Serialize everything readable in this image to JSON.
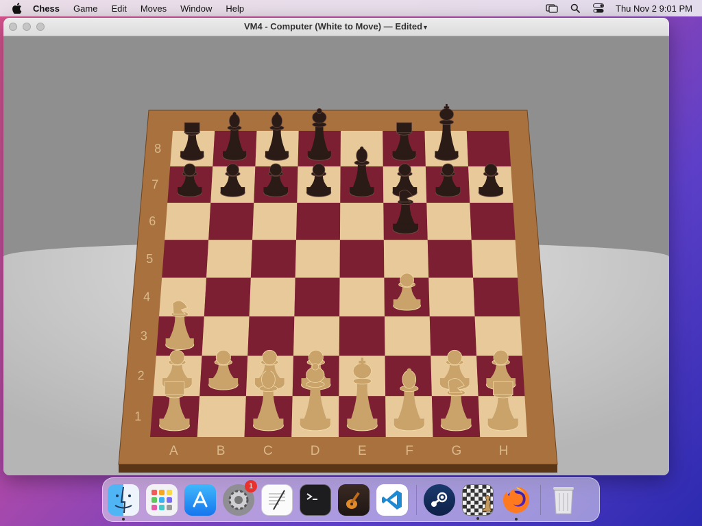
{
  "menubar": {
    "app_name": "Chess",
    "items": [
      "Game",
      "Edit",
      "Moves",
      "Window",
      "Help"
    ],
    "clock": "Thu Nov 2  9:01 PM"
  },
  "window": {
    "title": "VM4 - Computer   (White to Move) —",
    "edited": "Edited"
  },
  "board": {
    "files": [
      "A",
      "B",
      "C",
      "D",
      "E",
      "F",
      "G",
      "H"
    ],
    "ranks": [
      "8",
      "7",
      "6",
      "5",
      "4",
      "3",
      "2",
      "1"
    ],
    "colors": {
      "light": "#e8c99a",
      "dark": "#7d1f33",
      "frame": "#a8713e"
    },
    "pieces": [
      {
        "square": "a8",
        "piece": "rook",
        "color": "black"
      },
      {
        "square": "b8",
        "piece": "bishop",
        "color": "black"
      },
      {
        "square": "c8",
        "piece": "bishop",
        "color": "black"
      },
      {
        "square": "d8",
        "piece": "queen",
        "color": "black"
      },
      {
        "square": "f8",
        "piece": "rook",
        "color": "black"
      },
      {
        "square": "g8",
        "piece": "king",
        "color": "black"
      },
      {
        "square": "a7",
        "piece": "pawn",
        "color": "black"
      },
      {
        "square": "b7",
        "piece": "pawn",
        "color": "black"
      },
      {
        "square": "c7",
        "piece": "pawn",
        "color": "black"
      },
      {
        "square": "d7",
        "piece": "pawn",
        "color": "black"
      },
      {
        "square": "e7",
        "piece": "bishop",
        "color": "black"
      },
      {
        "square": "f7",
        "piece": "pawn",
        "color": "black"
      },
      {
        "square": "g7",
        "piece": "pawn",
        "color": "black"
      },
      {
        "square": "h7",
        "piece": "pawn",
        "color": "black"
      },
      {
        "square": "f6",
        "piece": "knight",
        "color": "black"
      },
      {
        "square": "f4",
        "piece": "pawn",
        "color": "white"
      },
      {
        "square": "a3",
        "piece": "knight",
        "color": "white"
      },
      {
        "square": "a2",
        "piece": "pawn",
        "color": "white"
      },
      {
        "square": "b2",
        "piece": "pawn",
        "color": "white"
      },
      {
        "square": "c2",
        "piece": "pawn",
        "color": "white"
      },
      {
        "square": "d2",
        "piece": "pawn",
        "color": "white"
      },
      {
        "square": "g2",
        "piece": "pawn",
        "color": "white"
      },
      {
        "square": "h2",
        "piece": "pawn",
        "color": "white"
      },
      {
        "square": "a1",
        "piece": "rook",
        "color": "white"
      },
      {
        "square": "c1",
        "piece": "bishop",
        "color": "white"
      },
      {
        "square": "d1",
        "piece": "queen",
        "color": "white"
      },
      {
        "square": "e1",
        "piece": "king",
        "color": "white"
      },
      {
        "square": "f1",
        "piece": "bishop",
        "color": "white"
      },
      {
        "square": "g1",
        "piece": "knight",
        "color": "white"
      },
      {
        "square": "h1",
        "piece": "rook",
        "color": "white"
      }
    ]
  },
  "dock": {
    "items": [
      {
        "name": "finder",
        "running": true
      },
      {
        "name": "launchpad",
        "running": false
      },
      {
        "name": "app-store",
        "running": false
      },
      {
        "name": "system-preferences",
        "running": false,
        "badge": "1"
      },
      {
        "name": "textedit",
        "running": false
      },
      {
        "name": "terminal",
        "running": false
      },
      {
        "name": "garageband",
        "running": false
      },
      {
        "name": "vscode",
        "running": false
      },
      {
        "name": "steam",
        "running": false
      },
      {
        "name": "chess",
        "running": true
      },
      {
        "name": "firefox",
        "running": true
      },
      {
        "name": "trash",
        "running": false
      }
    ]
  }
}
